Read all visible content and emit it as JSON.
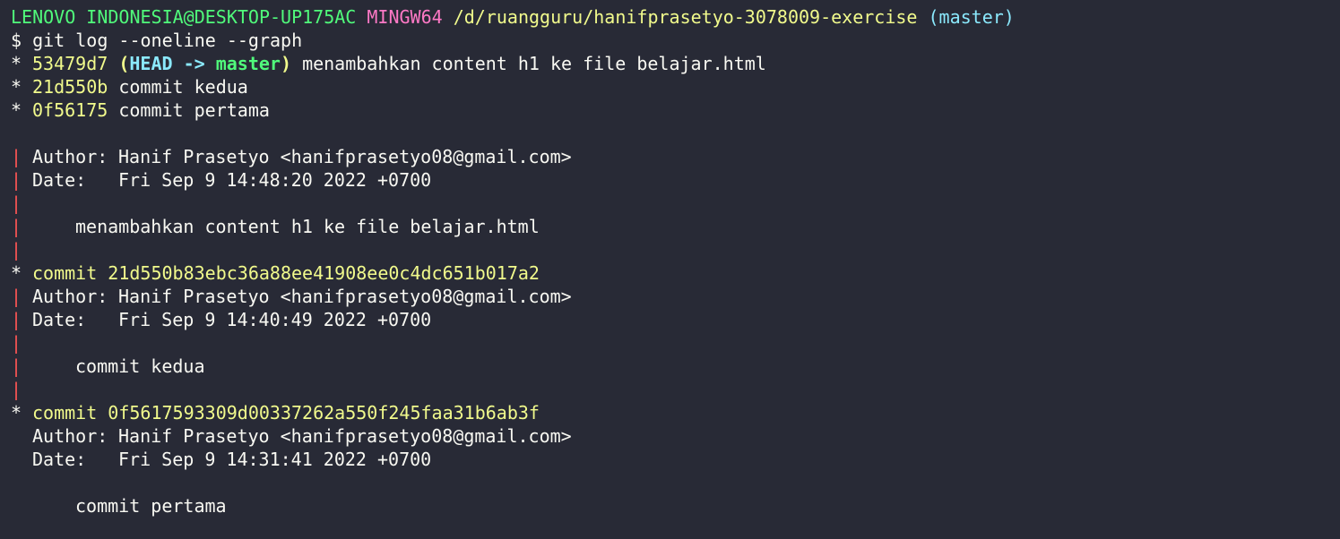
{
  "prompt": {
    "user_host": "LENOVO INDONESIA@DESKTOP-UP175AC",
    "shell": "MINGW64",
    "path": "/d/ruangguru/hanifprasetyo-3078009-exercise",
    "branch": "(master)",
    "symbol": "$",
    "command": "git log --oneline --graph"
  },
  "oneline": [
    {
      "hash": "53479d7",
      "open": "(",
      "head": "HEAD -> master",
      "close": ")",
      "msg": "menambahkan content h1 ke file belajar.html"
    },
    {
      "hash": "21d550b",
      "msg": "commit kedua"
    },
    {
      "hash": "0f56175",
      "msg": "commit pertama"
    }
  ],
  "graph": {
    "star": "*",
    "pipe": "|"
  },
  "commits": [
    {
      "author_label": "Author:",
      "author": "Hanif Prasetyo <hanifprasetyo08@gmail.com>",
      "date_label": "Date:",
      "date": "Fri Sep 9 14:48:20 2022 +0700",
      "message": "menambahkan content h1 ke file belajar.html"
    },
    {
      "commit_label": "commit",
      "hash": "21d550b83ebc36a88ee41908ee0c4dc651b017a2",
      "author_label": "Author:",
      "author": "Hanif Prasetyo <hanifprasetyo08@gmail.com>",
      "date_label": "Date:",
      "date": "Fri Sep 9 14:40:49 2022 +0700",
      "message": "commit kedua"
    },
    {
      "commit_label": "commit",
      "hash": "0f5617593309d00337262a550f245faa31b6ab3f",
      "author_label": "Author:",
      "author": "Hanif Prasetyo <hanifprasetyo08@gmail.com>",
      "date_label": "Date:",
      "date": "Fri Sep 9 14:31:41 2022 +0700",
      "message": "commit pertama"
    }
  ],
  "colors": {
    "background": "#282a36",
    "text": "#f8f8f2",
    "green": "#50fa7b",
    "magenta": "#ff79c6",
    "yellow": "#f1fa8c",
    "cyan": "#8be9fd",
    "graph_line": "#ff5555"
  }
}
